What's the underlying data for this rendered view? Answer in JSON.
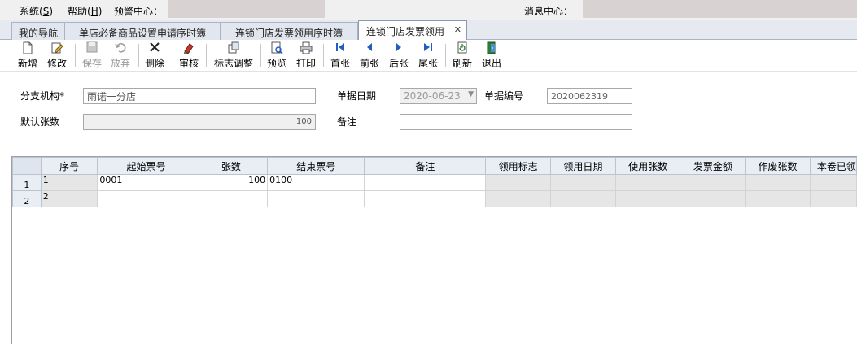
{
  "menubar": {
    "items": [
      {
        "label": "系统(",
        "key": "S",
        "tail": ")"
      },
      {
        "label": "帮助(",
        "key": "H",
        "tail": ")"
      }
    ],
    "warning_center": "预警中心：",
    "message_center": "消息中心："
  },
  "tabs": [
    {
      "label": "我的导航"
    },
    {
      "label": "单店必备商品设置申请序时簿"
    },
    {
      "label": "连锁门店发票领用序时簿"
    },
    {
      "label": "连锁门店发票领用",
      "active": true
    }
  ],
  "toolbar": {
    "buttons": [
      {
        "label": "新增",
        "icon": "new-doc-icon",
        "enabled": true
      },
      {
        "label": "修改",
        "icon": "edit-icon",
        "enabled": true
      },
      {
        "label": "保存",
        "icon": "save-icon",
        "enabled": false
      },
      {
        "label": "放弃",
        "icon": "undo-icon",
        "enabled": false
      },
      {
        "label": "删除",
        "icon": "delete-icon",
        "enabled": true
      },
      {
        "label": "审核",
        "icon": "approve-icon",
        "enabled": true
      },
      {
        "label": "标志调整",
        "icon": "flag-adjust-icon",
        "enabled": true
      },
      {
        "label": "预览",
        "icon": "preview-icon",
        "enabled": true
      },
      {
        "label": "打印",
        "icon": "print-icon",
        "enabled": true
      },
      {
        "label": "首张",
        "icon": "first-icon",
        "enabled": true
      },
      {
        "label": "前张",
        "icon": "prev-icon",
        "enabled": true
      },
      {
        "label": "后张",
        "icon": "next-icon",
        "enabled": true
      },
      {
        "label": "尾张",
        "icon": "last-icon",
        "enabled": true
      },
      {
        "label": "刷新",
        "icon": "refresh-icon",
        "enabled": true
      },
      {
        "label": "退出",
        "icon": "exit-icon",
        "enabled": true
      }
    ]
  },
  "form": {
    "branch_label": "分支机构*",
    "branch_value": "雨诺一分店",
    "date_label": "单据日期",
    "date_value": "2020-06-23",
    "docno_label": "单据编号",
    "docno_value": "2020062319",
    "default_count_label": "默认张数",
    "default_count_value": "100",
    "remark_label": "备注",
    "remark_value": ""
  },
  "grid": {
    "columns": [
      "序号",
      "起始票号",
      "张数",
      "结束票号",
      "备注",
      "领用标志",
      "领用日期",
      "使用张数",
      "发票金额",
      "作废张数",
      "本卷已领"
    ],
    "rows": [
      {
        "row_number": "1",
        "cells": [
          "1",
          "0001",
          "100",
          "0100",
          "",
          "",
          "",
          "",
          "",
          "",
          ""
        ]
      },
      {
        "row_number": "2",
        "cells": [
          "2",
          "",
          "",
          "",
          "",
          "",
          "",
          "",
          "",
          "",
          ""
        ]
      }
    ]
  },
  "colors": {
    "accent_blue": "#1f5fbf",
    "delete_red": "#c0392b"
  }
}
